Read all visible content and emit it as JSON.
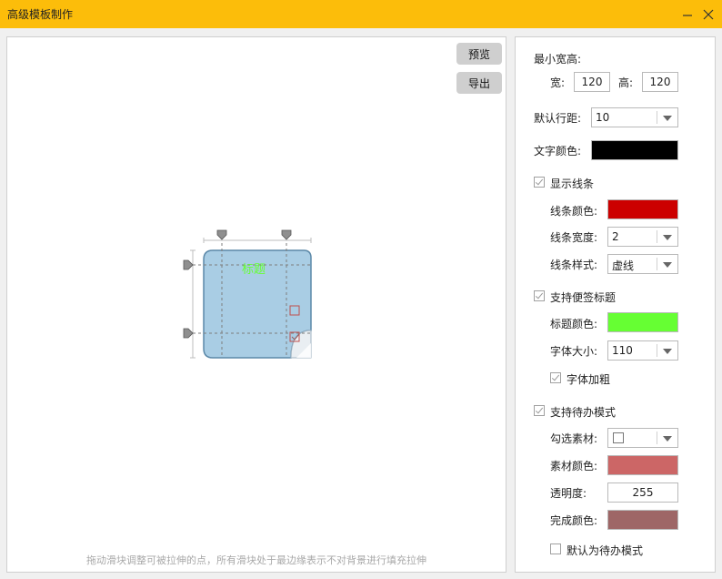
{
  "window": {
    "title": "高级模板制作",
    "minimize_icon": "minimize-icon",
    "close_icon": "close-icon"
  },
  "canvas": {
    "preview_label": "预览",
    "export_label": "导出",
    "note_title": "标题",
    "hint": "拖动滑块调整可被拉伸的点，所有滑块处于最边缘表示不对背景进行填充拉伸",
    "note_color": "#a9cde4",
    "note_border": "#5b88a8"
  },
  "settings": {
    "min_size_label": "最小宽高:",
    "width_label": "宽:",
    "width_value": "120",
    "height_label": "高:",
    "height_value": "120",
    "line_spacing_label": "默认行距:",
    "line_spacing_value": "10",
    "text_color_label": "文字颜色:",
    "text_color": "#000000",
    "show_lines": {
      "label": "显示线条",
      "checked": true
    },
    "line_color_label": "线条颜色:",
    "line_color": "#cc0000",
    "line_width_label": "线条宽度:",
    "line_width_value": "2",
    "line_style_label": "线条样式:",
    "line_style_value": "虚线",
    "sticky_title": {
      "label": "支持便签标题",
      "checked": true
    },
    "title_color_label": "标题颜色:",
    "title_color": "#66ff33",
    "font_size_label": "字体大小:",
    "font_size_value": "110",
    "bold": {
      "label": "字体加粗",
      "checked": true
    },
    "todo_mode": {
      "label": "支持待办模式",
      "checked": true
    },
    "check_material_label": "勾选素材:",
    "material_color_label": "素材颜色:",
    "material_color": "#cc6666",
    "opacity_label": "透明度:",
    "opacity_value": "255",
    "done_color_label": "完成颜色:",
    "done_color": "#9e6666",
    "default_todo": {
      "label": "默认为待办模式",
      "checked": false
    }
  }
}
